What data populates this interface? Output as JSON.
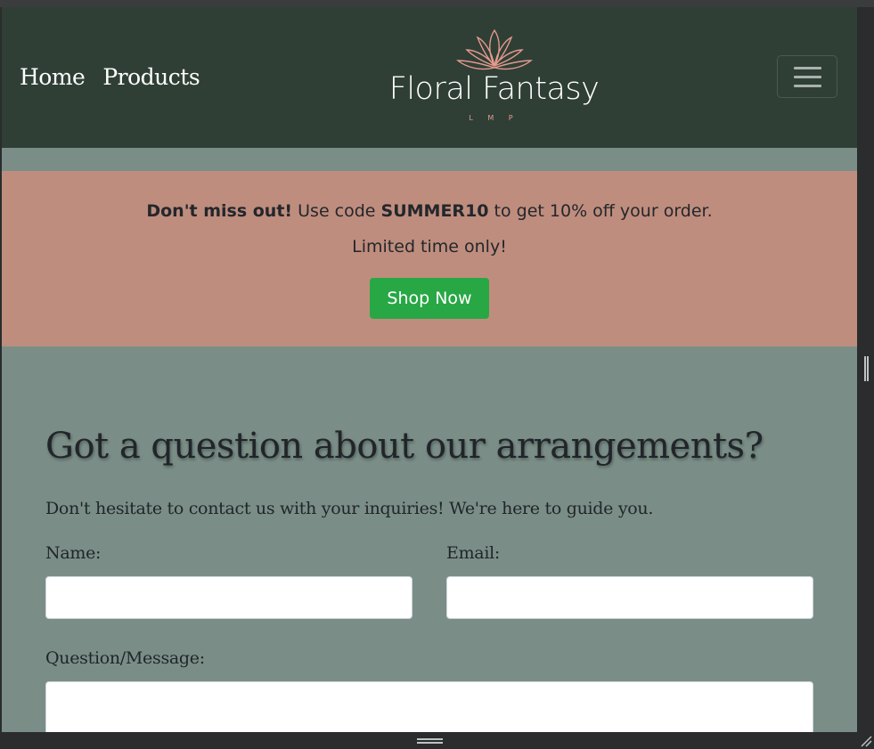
{
  "nav": {
    "links": [
      "Home",
      "Products"
    ],
    "brand": "Floral Fantasy",
    "brand_sub": "L M P"
  },
  "promo": {
    "bold_lead": "Don't miss out!",
    "text_a": " Use code ",
    "code": "SUMMER10",
    "text_b": " to get 10% off your order.",
    "line2": "Limited time only!",
    "button": "Shop Now"
  },
  "contact": {
    "title": "Got a question about our arrangements?",
    "subtitle": "Don't hesitate to contact us with your inquiries! We're here to guide you.",
    "name_label": "Name:",
    "email_label": "Email:",
    "message_label": "Question/Message:"
  },
  "colors": {
    "navbar": "#2f3f36",
    "page_bg": "#7a8e87",
    "promo_bg": "#bf8d7e",
    "button": "#28a745",
    "accent": "#e59a8d"
  },
  "icons": [
    "lotus-logo-icon",
    "hamburger-menu-icon",
    "resize-grip-icon"
  ]
}
